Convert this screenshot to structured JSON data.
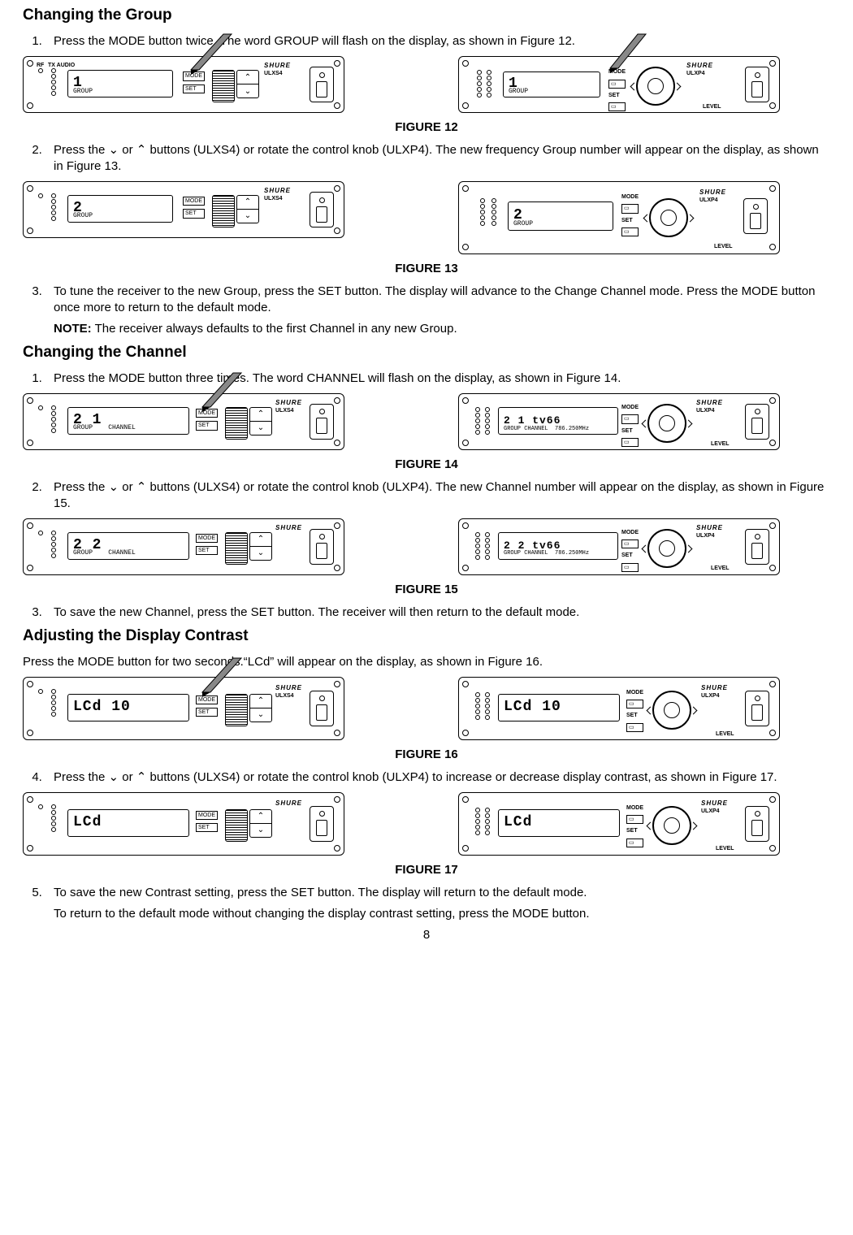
{
  "section_group": "Changing the Group",
  "group_step1": "Press the MODE button twice. The word GROUP will flash on the display, as shown in Figure 12.",
  "fig12": "FIGURE 12",
  "group_step2": "Press the ⌄ or ⌃ buttons (ULXS4) or rotate the control knob (ULXP4). The new frequency Group number will appear on the display, as shown in Figure 13.",
  "fig13": "FIGURE 13",
  "group_step3a": "To tune the receiver to the new Group, press the SET button. The display will advance to the Change Channel mode. Press the MODE button once more to return to the default mode.",
  "group_step3_note_lead": "NOTE:",
  "group_step3_note": " The receiver always defaults to the first Channel in any new Group.",
  "section_channel": "Changing the Channel",
  "channel_step1": "Press the MODE button three times. The word CHANNEL will flash on the display, as shown in Figure 14.",
  "fig14": "FIGURE 14",
  "channel_step2": "Press the ⌄ or ⌃ buttons (ULXS4) or rotate the control knob (ULXP4). The new Channel number will appear on the display, as shown in Figure 15.",
  "fig15": "FIGURE 15",
  "channel_step3": "To save the new Channel, press the SET button. The receiver will then return to the default mode.",
  "section_contrast": "Adjusting the Display Contrast",
  "contrast_intro": "Press the MODE button for two seconds.“LCd” will appear on the display, as shown in Figure 16.",
  "fig16": "FIGURE 16",
  "contrast_step4": "Press the ⌄ or ⌃ buttons (ULXS4) or rotate the control knob (ULXP4) to increase or decrease display contrast, as shown in Figure 17.",
  "fig17": "FIGURE 17",
  "contrast_step5a": "To save the new Contrast setting, press the SET button. The display will  return to the default mode.",
  "contrast_step5b": "To return to the default mode without changing the display contrast setting, press the MODE button.",
  "page_number": "8",
  "labels": {
    "mode": "MODE",
    "set": "SET",
    "level": "LEVEL",
    "brand_s": "SHURE",
    "model_s": "ULXS4",
    "model_p": "ULXP4",
    "group_word": "GROUP",
    "channel_word": "CHANNEL",
    "rf": "RF",
    "audio": "AUDIO",
    "tx": "TX"
  },
  "lcd": {
    "g1": "1",
    "g2": "2",
    "ch21_1": "2   1",
    "ch22_2": "2   2",
    "ch_tv_a": "2  1  tv66",
    "ch_freq_a": "786.250",
    "ch_tv_b": "2  2  tv66",
    "ch_freq_b": "786.250",
    "lcd10": "LCd   10",
    "lcd": "LCd"
  }
}
